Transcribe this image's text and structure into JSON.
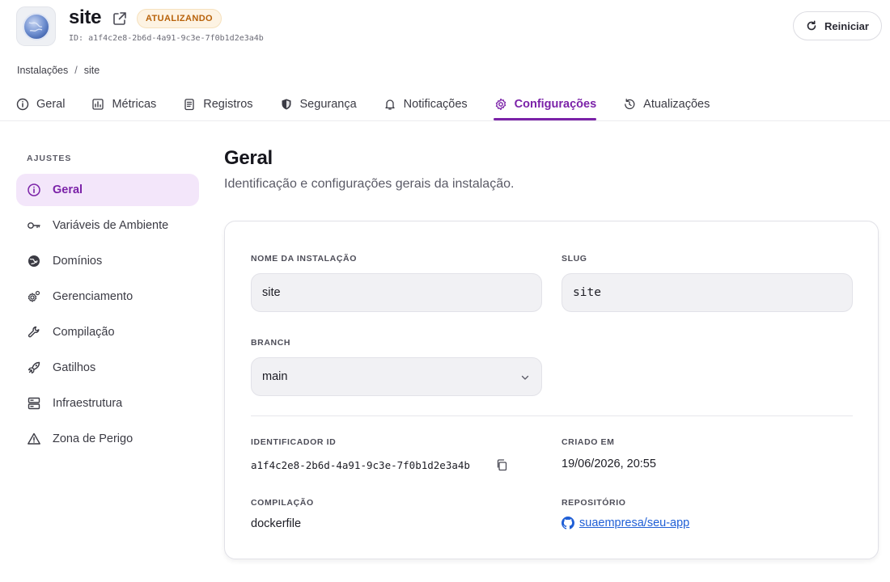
{
  "header": {
    "app_name": "site",
    "status": "ATUALIZANDO",
    "id_text": "ID: a1f4c2e8-2b6d-4a91-9c3e-7f0b1d2e3a4b",
    "restart_label": "Reiniciar"
  },
  "breadcrumb": {
    "items": [
      "Instalações",
      "site"
    ],
    "separator": "/"
  },
  "tabs": [
    {
      "label": "Geral",
      "icon": "info-icon"
    },
    {
      "label": "Métricas",
      "icon": "chart-icon"
    },
    {
      "label": "Registros",
      "icon": "log-icon"
    },
    {
      "label": "Segurança",
      "icon": "shield-icon"
    },
    {
      "label": "Notificações",
      "icon": "bell-icon"
    },
    {
      "label": "Configurações",
      "icon": "gear-icon",
      "active": true
    },
    {
      "label": "Atualizações",
      "icon": "history-icon"
    }
  ],
  "sidebar": {
    "heading": "AJUSTES",
    "items": [
      {
        "label": "Geral",
        "icon": "info-icon",
        "active": true
      },
      {
        "label": "Variáveis de Ambiente",
        "icon": "key-icon"
      },
      {
        "label": "Domínios",
        "icon": "globe-icon"
      },
      {
        "label": "Gerenciamento",
        "icon": "cogs-icon"
      },
      {
        "label": "Compilação",
        "icon": "wrench-icon"
      },
      {
        "label": "Gatilhos",
        "icon": "rocket-icon"
      },
      {
        "label": "Infraestrutura",
        "icon": "server-icon"
      },
      {
        "label": "Zona de Perigo",
        "icon": "warning-icon"
      }
    ]
  },
  "main": {
    "title": "Geral",
    "subtitle": "Identificação e configurações gerais da instalação.",
    "fields": {
      "name_label": "NOME DA INSTALAÇÃO",
      "name_value": "site",
      "slug_label": "SLUG",
      "slug_value": "site",
      "branch_label": "BRANCH",
      "branch_value": "main",
      "identifier_label": "IDENTIFICADOR ID",
      "identifier_value": "a1f4c2e8-2b6d-4a91-9c3e-7f0b1d2e3a4b",
      "created_label": "CRIADO EM",
      "created_value": "19/06/2026, 20:55",
      "build_label": "COMPILAÇÃO",
      "build_value": "dockerfile",
      "repo_label": "REPOSITÓRIO",
      "repo_value": "suaempresa/seu-app"
    }
  },
  "colors": {
    "accent": "#7b22a8",
    "accent_bg": "#f3e6fa",
    "status_text": "#b8620a",
    "status_bg": "#fdf3e3",
    "link": "#1f5fd6"
  }
}
